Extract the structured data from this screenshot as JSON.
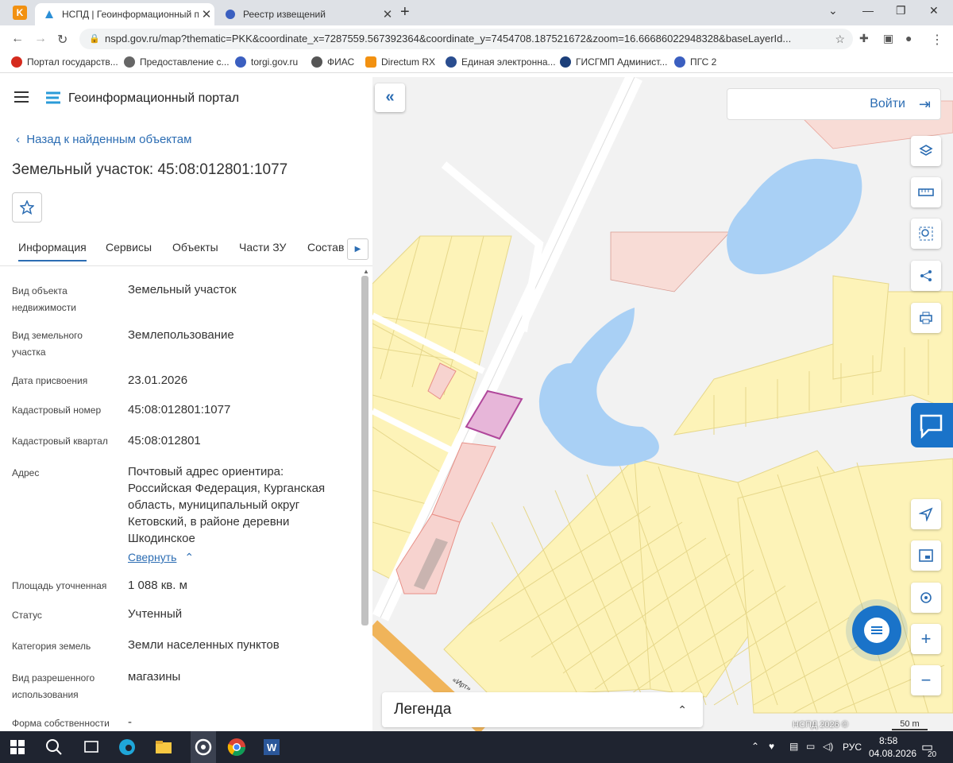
{
  "browser": {
    "tabs": [
      {
        "title": "НСПД | Геоинформационный п",
        "active": true
      },
      {
        "title": "Реестр извещений",
        "active": false
      }
    ],
    "url": "nspd.gov.ru/map?thematic=PKK&coordinate_x=7287559.567392364&coordinate_y=7454708.187521672&zoom=16.66686022948328&baseLayerId...",
    "bookmarks": [
      "Портал государств...",
      "Предоставление с...",
      "torgi.gov.ru",
      "ФИАС",
      "Directum RX",
      "Единая электронна...",
      "ГИСГМП Админист...",
      "ПГС 2"
    ]
  },
  "portal": {
    "brand": "Геоинформационный портал",
    "back_label": "Назад к найденным объектам",
    "title": "Земельный участок: 45:08:012801:1077",
    "tabs": [
      "Информация",
      "Сервисы",
      "Объекты",
      "Части ЗУ",
      "Состав"
    ],
    "collapse_link": "Свернуть",
    "fields": [
      {
        "label": "Вид объекта недвижимости",
        "value": "Земельный участок"
      },
      {
        "label": "Вид земельного участка",
        "value": "Землепользование"
      },
      {
        "label": "Дата присвоения",
        "value": "23.01.2026"
      },
      {
        "label": "Кадастровый номер",
        "value": "45:08:012801:1077"
      },
      {
        "label": "Кадастровый квартал",
        "value": "45:08:012801"
      },
      {
        "label": "Адрес",
        "value": "Почтовый адрес ориентира: Российская Федерация, Курганская область, муниципальный округ Кетовский, в районе деревни Шкодинское"
      },
      {
        "label": "Площадь уточненная",
        "value": "1 088 кв. м"
      },
      {
        "label": "Статус",
        "value": "Учтенный"
      },
      {
        "label": "Категория земель",
        "value": "Земли населенных пунктов"
      },
      {
        "label": "Вид разрешенного использования",
        "value": "магазины"
      },
      {
        "label": "Форма собственности",
        "value": "-"
      }
    ]
  },
  "map": {
    "login_label": "Войти",
    "legend_label": "Легенда",
    "copyright": "НСПД 2026 ©",
    "scale_label": "50 m",
    "road_label": "«Ирт»",
    "colors": {
      "parcel": "#fdf3b8",
      "parcel_border": "#e6d78a",
      "water": "#a9d0f5",
      "selected": "#b0479b",
      "highlight": "#f7d3cf",
      "accent": "#1a73c9"
    }
  },
  "taskbar": {
    "time": "8:58",
    "date": "04.08.2026",
    "lang": "РУС",
    "notifications": "20"
  }
}
